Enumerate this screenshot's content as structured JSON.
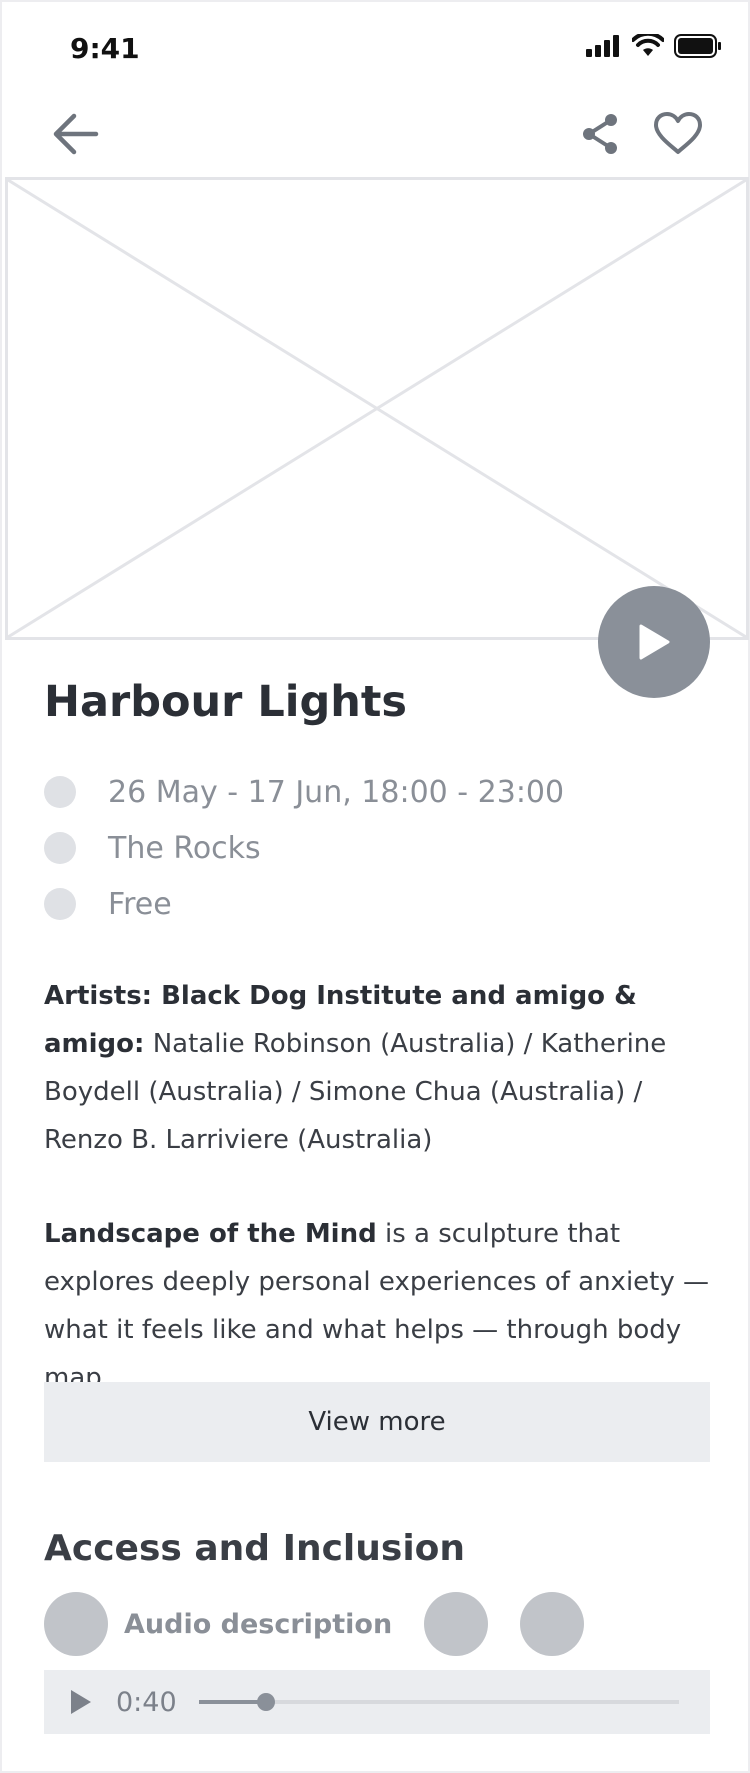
{
  "status_bar": {
    "time": "9:41"
  },
  "nav": {
    "back_icon": "arrow-left-icon",
    "share_icon": "share-icon",
    "favorite_icon": "heart-icon"
  },
  "event": {
    "title": "Harbour Lights",
    "meta": [
      {
        "icon": "calendar-icon",
        "text": "26 May - 17 Jun, 18:00 - 23:00"
      },
      {
        "icon": "location-icon",
        "text": "The Rocks"
      },
      {
        "icon": "ticket-icon",
        "text": "Free"
      }
    ],
    "artists_label": "Artists: Black Dog Institute and amigo & amigo:",
    "artists_text": "Natalie Robinson (Australia) / Katherine Boydell (Australia) / Simone Chua (Australia) / Renzo  B. Larriviere (Australia)",
    "blurb_bold": "Landscape of the Mind",
    "blurb_text": "is a sculpture that explores deeply personal experiences of anxiety — what it feels like and what helps — through body map...",
    "view_more_label": "View more"
  },
  "access": {
    "title": "Access and Inclusion",
    "items": [
      {
        "icon": "audio-description-icon",
        "label": "Audio description"
      },
      {
        "icon": "access-icon-2",
        "label": ""
      },
      {
        "icon": "access-icon-3",
        "label": ""
      }
    ]
  },
  "audio_player": {
    "time": "0:40",
    "progress": 0.14
  },
  "colors": {
    "accent_gray": "#8a9099",
    "muted_text": "#8a8f97",
    "panel_bg": "#ebedf0"
  }
}
